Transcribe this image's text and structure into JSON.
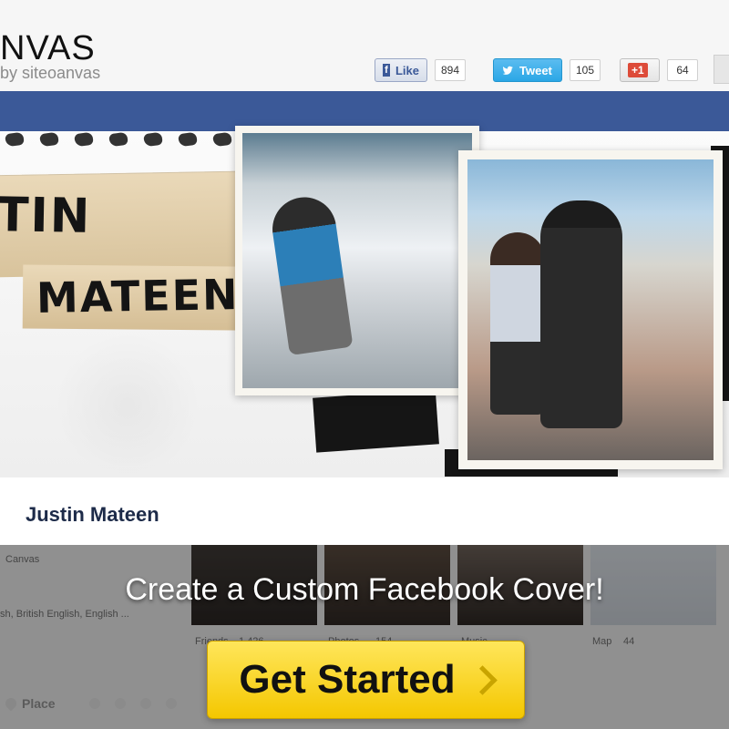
{
  "brand": {
    "logo_text": "NVAS",
    "tagline": "by siteoanvas"
  },
  "share": {
    "facebook": {
      "label": "Like",
      "count": "894",
      "mark": "f"
    },
    "twitter": {
      "label": "Tweet",
      "count": "105"
    },
    "googleplus": {
      "label": "+1",
      "count": "64"
    }
  },
  "cover": {
    "name_line1": "TIN",
    "name_line2": "MATEEN",
    "profile_name": "Justin Mateen"
  },
  "profile_strip": {
    "left_label": "Canvas",
    "left_lang": "sh, British English, English ...",
    "labels": [
      "Friends",
      "Photos",
      "Music",
      "Map"
    ],
    "counts": [
      "1,426",
      "154",
      "",
      "44"
    ]
  },
  "cta": {
    "headline": "Create a Custom Facebook Cover!",
    "button_label": "Get Started"
  },
  "bottom": {
    "place_label": "Place"
  },
  "icons": {
    "facebook": "facebook-icon",
    "twitter": "twitter-bird-icon",
    "arrow": "chevron-right-icon",
    "pin": "map-pin-icon"
  },
  "colors": {
    "facebook_blue": "#3b5998",
    "twitter_blue": "#2ba7e6",
    "cta_yellow": "#f4c700"
  }
}
